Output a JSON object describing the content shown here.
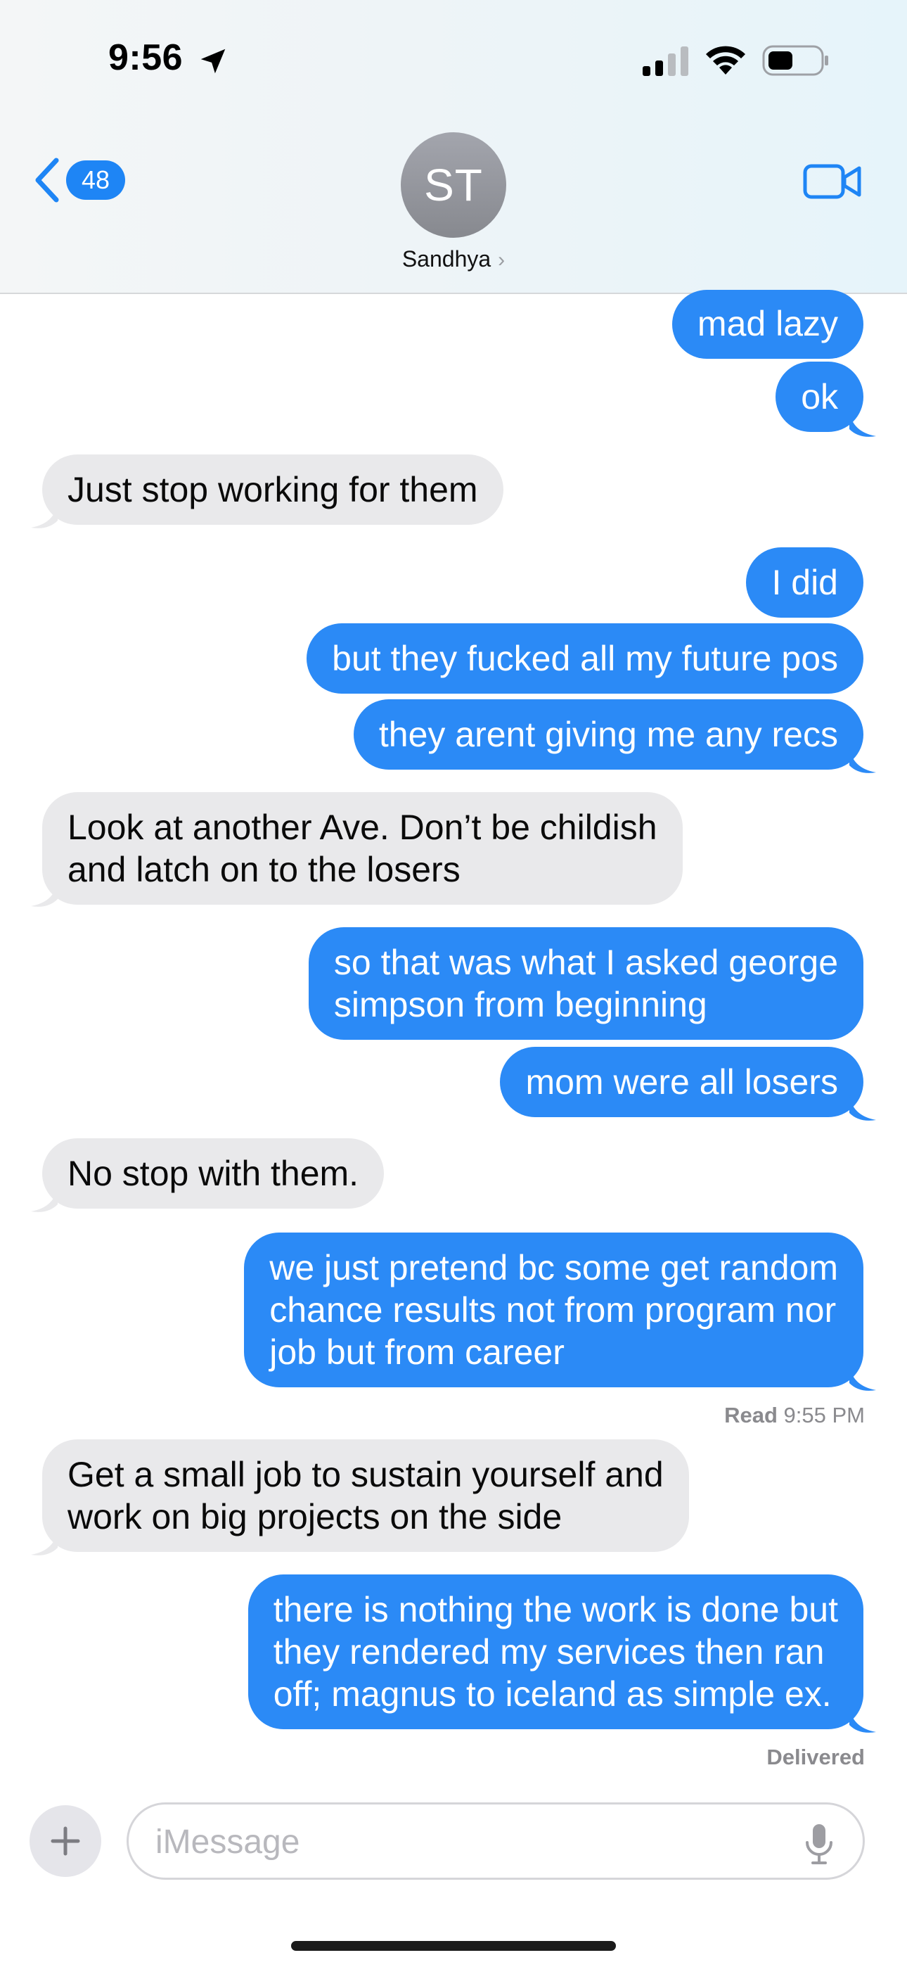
{
  "status_bar": {
    "time": "9:56"
  },
  "header": {
    "back_count": "48",
    "avatar_initials": "ST",
    "contact_name": "Sandhya",
    "contact_chevron": "›"
  },
  "messages": [
    {
      "dir": "out",
      "text": "mad lazy"
    },
    {
      "dir": "out",
      "text": "ok"
    },
    {
      "dir": "in",
      "text": "Just stop working for them"
    },
    {
      "dir": "out",
      "text": "I did"
    },
    {
      "dir": "out",
      "text": "but they fucked all my future pos"
    },
    {
      "dir": "out",
      "text": "they arent giving me any recs"
    },
    {
      "dir": "in",
      "lines": [
        "Look at another Ave.  Don’t be childish",
        "and latch on to the losers"
      ]
    },
    {
      "dir": "out",
      "lines": [
        "so that was what I asked george",
        "simpson from beginning"
      ]
    },
    {
      "dir": "out",
      "text": "mom were all losers"
    },
    {
      "dir": "in",
      "text": "No stop with them."
    },
    {
      "dir": "out",
      "lines": [
        "we just pretend bc some get random",
        "chance results not from program nor",
        "job but from career"
      ]
    },
    {
      "dir": "in",
      "lines": [
        "Get a small job to sustain yourself and",
        "work on big projects on the side"
      ]
    },
    {
      "dir": "out",
      "lines": [
        "there is nothing the work is done but",
        "they rendered my services then ran",
        "off; magnus to iceland as simple ex."
      ]
    }
  ],
  "read_receipt": {
    "label": "Read",
    "time": "9:55 PM"
  },
  "delivered_label": "Delivered",
  "input": {
    "placeholder": "iMessage"
  },
  "colors": {
    "outgoing_bubble": "#2b8af6",
    "incoming_bubble": "#e9e9eb",
    "accent": "#1e85f5",
    "avatar": "#9a9ca3"
  },
  "icons": {
    "location": "location-arrow-icon",
    "signal": "cellular-signal-icon",
    "wifi": "wifi-icon",
    "battery": "battery-icon",
    "back": "chevron-left-icon",
    "video": "video-camera-icon",
    "plus": "plus-icon",
    "mic": "microphone-icon"
  }
}
